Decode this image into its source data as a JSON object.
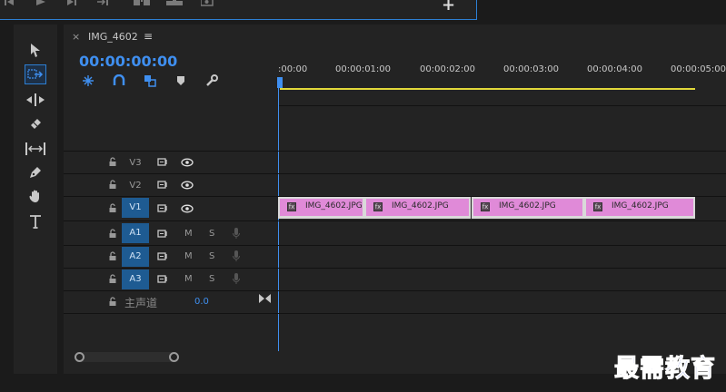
{
  "monitor": {
    "add_button_label": "+"
  },
  "tools": [
    {
      "name": "selection-tool",
      "icon": "arrow-icon"
    },
    {
      "name": "track-select-forward-tool",
      "icon": "track-select-icon",
      "active": true
    },
    {
      "name": "ripple-edit-tool",
      "icon": "ripple-edit-icon"
    },
    {
      "name": "razor-tool",
      "icon": "razor-icon"
    },
    {
      "name": "slip-tool",
      "icon": "slip-icon"
    },
    {
      "name": "pen-tool",
      "icon": "pen-icon"
    },
    {
      "name": "hand-tool",
      "icon": "hand-icon"
    },
    {
      "name": "type-tool",
      "icon": "type-icon"
    }
  ],
  "timeline": {
    "tab_close": "×",
    "tab_title": "IMG_4602",
    "tab_menu": "≡",
    "timecode": "00:00:00:00",
    "ruler": [
      ":00:00",
      "00:00:01:00",
      "00:00:02:00",
      "00:00:03:00",
      "00:00:04:00",
      "00:00:05:00"
    ],
    "video_tracks": [
      {
        "label": "V3",
        "selected": false
      },
      {
        "label": "V2",
        "selected": false
      },
      {
        "label": "V1",
        "selected": true
      }
    ],
    "audio_tracks": [
      {
        "label": "A1",
        "m": "M",
        "s": "S"
      },
      {
        "label": "A2",
        "m": "M",
        "s": "S"
      },
      {
        "label": "A3",
        "m": "M",
        "s": "S"
      }
    ],
    "mix": {
      "label": "主声道",
      "value": "0.0"
    },
    "clips": [
      {
        "name": "IMG_4602.JPG",
        "fx": "fx"
      },
      {
        "name": "IMG_4602.JPG",
        "fx": "fx"
      },
      {
        "name": "IMG_4602.JPG",
        "fx": "fx"
      },
      {
        "name": "IMG_4602.JPG",
        "fx": "fx"
      }
    ]
  },
  "watermark": "最需教育",
  "colors": {
    "accent": "#3f8ff0",
    "clip": "#e08ad8",
    "work_area": "#e1d83a",
    "track_selected": "#1e5b92"
  }
}
